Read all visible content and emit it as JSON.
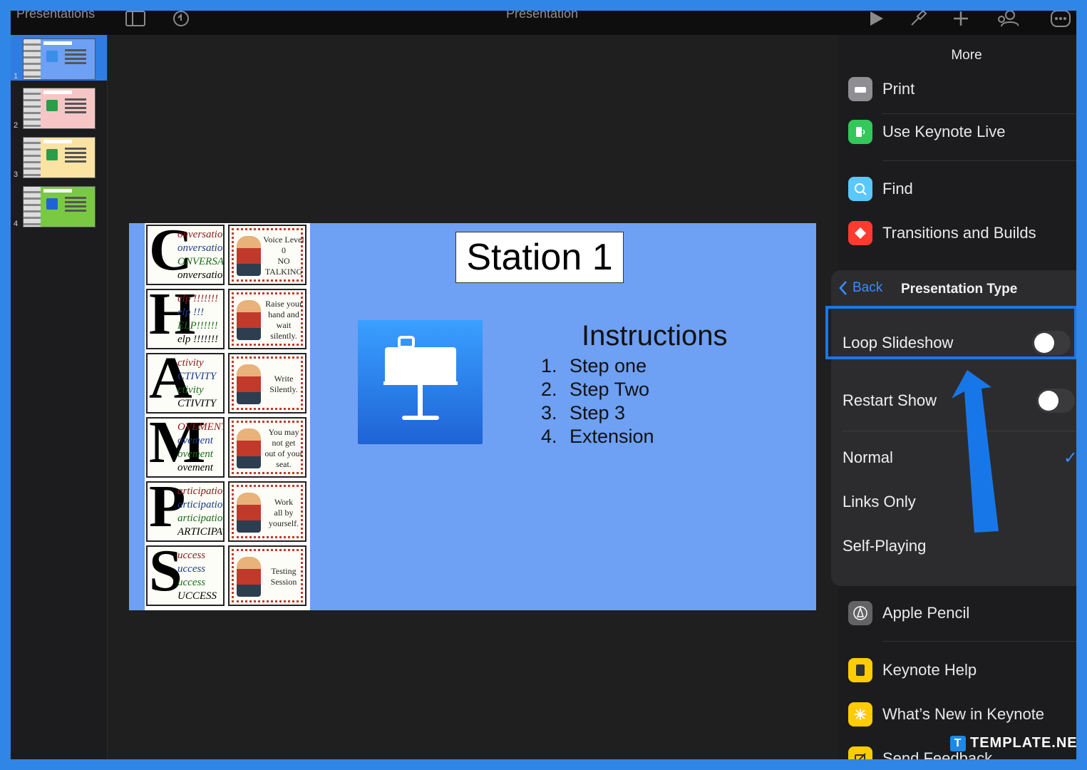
{
  "toolbar": {
    "back_label": "Presentations",
    "doc_title": "Presentation"
  },
  "sidebar": {
    "slides": [
      {
        "number": "1",
        "color": "#6ea0f4"
      },
      {
        "number": "2",
        "color": "#f6c6c6"
      },
      {
        "number": "3",
        "color": "#fbe3a3"
      },
      {
        "number": "4",
        "color": "#7ac943"
      }
    ]
  },
  "slide": {
    "title": "Station 1",
    "instructions_title": "Instructions",
    "steps": [
      {
        "num": "1.",
        "text": "Step one"
      },
      {
        "num": "2.",
        "text": "Step Two"
      },
      {
        "num": "3.",
        "text": "Step 3"
      },
      {
        "num": "4.",
        "text": "Extension"
      }
    ],
    "champ": [
      {
        "letter": "C",
        "words": [
          "onversation",
          "onversation",
          "ONVERSATION",
          "onversation"
        ],
        "pic": [
          "Voice Level",
          "0",
          "NO",
          "TALKING"
        ]
      },
      {
        "letter": "H",
        "words": [
          "elp !!!!!!!",
          "elp !!!",
          "ELP!!!!!!",
          "elp !!!!!!!"
        ],
        "pic": [
          "Raise your",
          "hand and",
          "wait silently."
        ]
      },
      {
        "letter": "A",
        "words": [
          "ctivity",
          "CTIVITY",
          "ctivity",
          "CTIVITY"
        ],
        "pic": [
          "Write",
          "Silently."
        ]
      },
      {
        "letter": "M",
        "words": [
          "OVEMENT",
          "ovement",
          "ovement",
          "ovement"
        ],
        "pic": [
          "You may",
          "not get",
          "out of your",
          "seat."
        ]
      },
      {
        "letter": "P",
        "words": [
          "articipation",
          "articipation",
          "articipation",
          "ARTICIPATION"
        ],
        "pic": [
          "Work",
          "all by",
          "yourself."
        ]
      },
      {
        "letter": "S",
        "words": [
          "uccess",
          "uccess",
          "uccess",
          "UCCESS"
        ],
        "pic": [
          "Testing Session"
        ]
      }
    ]
  },
  "panel": {
    "title": "More",
    "items_top": [
      {
        "label": "Print",
        "icon": "print-icon",
        "color": "#8e8e93"
      },
      {
        "label": "Use Keynote Live",
        "icon": "keynote-live-icon",
        "color": "#34c759"
      },
      {
        "label": "Find",
        "icon": "find-icon",
        "color": "#5ac8fa"
      },
      {
        "label": "Transitions and Builds",
        "icon": "transitions-icon",
        "color": "#ff3b30"
      }
    ],
    "items_bottom": [
      {
        "label": "Apple Pencil",
        "icon": "apple-pencil-icon",
        "color": "#8e8e93"
      },
      {
        "label": "Keynote Help",
        "icon": "keynote-help-icon",
        "color": "#ffcc00"
      },
      {
        "label": "What’s New in Keynote",
        "icon": "whats-new-icon",
        "color": "#ffcc00"
      },
      {
        "label": "Send Feedback",
        "icon": "send-feedback-icon",
        "color": "#ffcc00"
      }
    ]
  },
  "popover": {
    "back_label": "Back",
    "title": "Presentation Type",
    "loop_label": "Loop Slideshow",
    "loop_on": false,
    "restart_label": "Restart Show",
    "restart_on": false,
    "types": [
      {
        "label": "Normal",
        "selected": true
      },
      {
        "label": "Links Only",
        "selected": false
      },
      {
        "label": "Self-Playing",
        "selected": false
      }
    ],
    "check_mark": "✓"
  },
  "watermark": {
    "logo": "T",
    "text": "TEMPLATE.NET"
  },
  "colors": {
    "accent": "#2f7de1",
    "highlight": "#1877e8",
    "slide_bg": "#6ea0f4"
  }
}
